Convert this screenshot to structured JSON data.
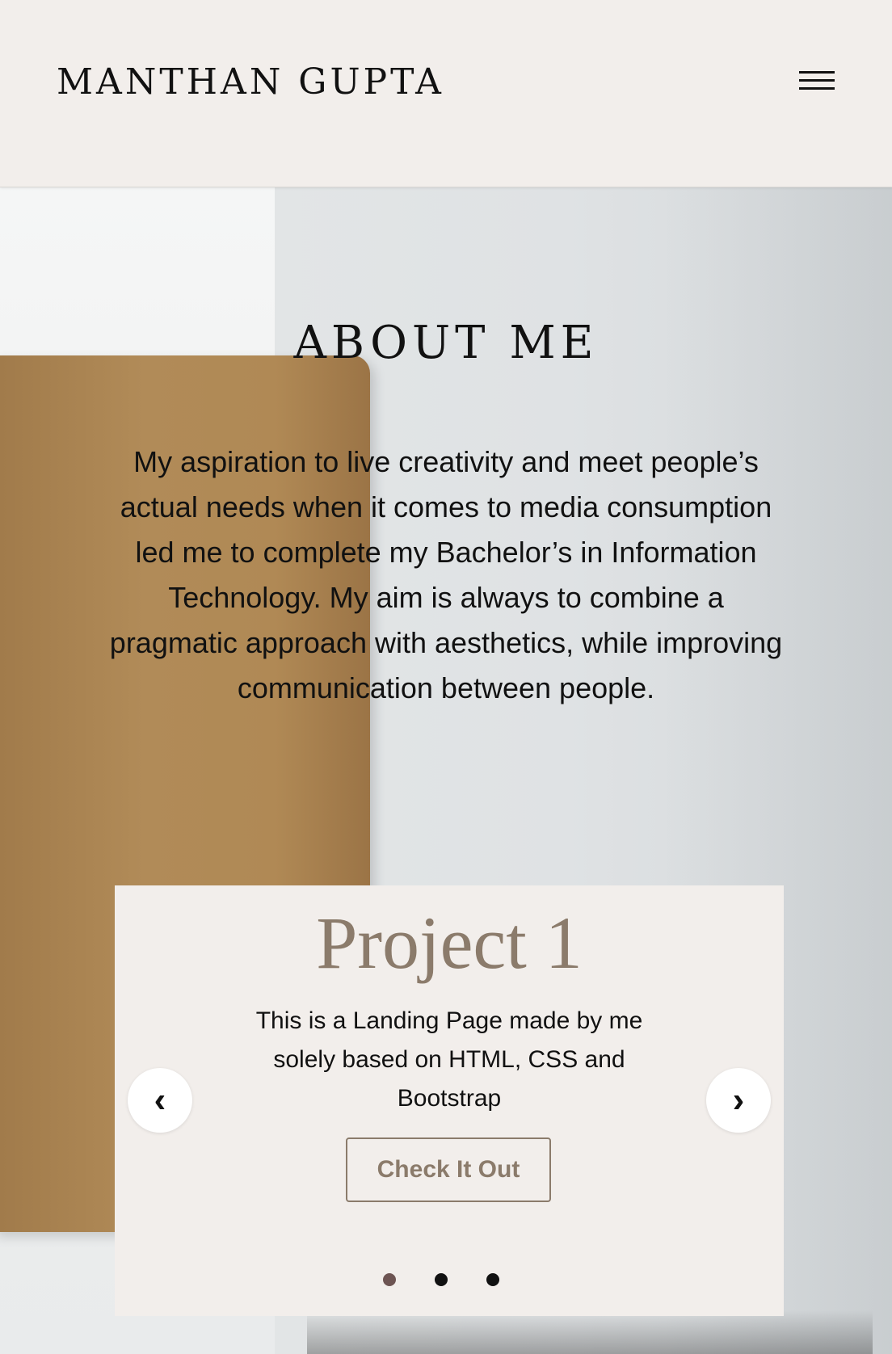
{
  "header": {
    "brand": "MANTHAN GUPTA",
    "menu_icon": "hamburger-icon"
  },
  "about": {
    "title": "ABOUT ME",
    "text": "My aspiration to live creativity and meet people’s actual needs when it comes to media consumption led me to complete my Bachelor’s in Information Technology. My aim is always to combine a pragmatic approach with aesthetics, while improving communication between people."
  },
  "carousel": {
    "slide": {
      "title": "Project 1",
      "description": "This is a Landing Page made by me solely based on HTML, CSS and Bootstrap",
      "button_label": "Check It Out"
    },
    "prev_icon": "‹",
    "next_icon": "›",
    "active_index": 0,
    "slide_count": 3
  },
  "colors": {
    "navbar_bg": "#f2eeeb",
    "accent": "#8b7b6b",
    "active_dot": "#6d5452",
    "text": "#111111"
  }
}
